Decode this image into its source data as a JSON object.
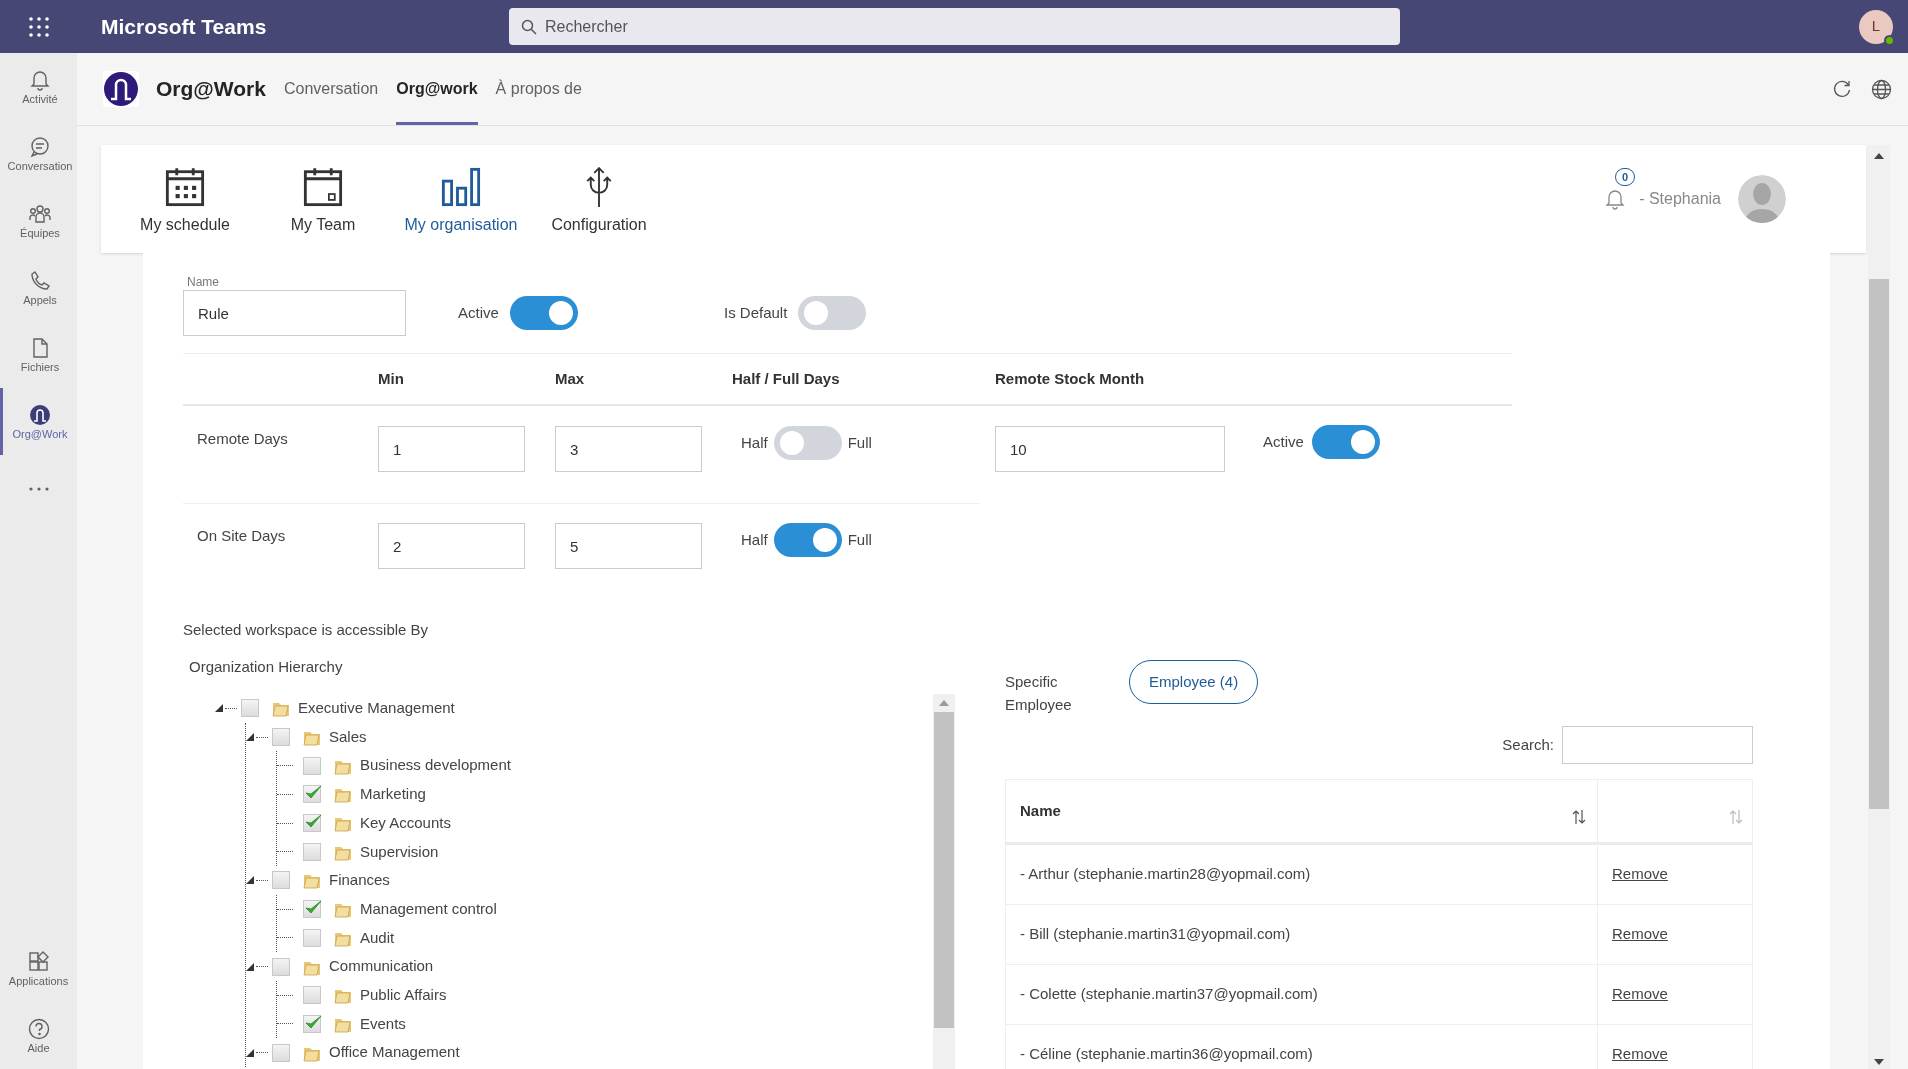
{
  "app_bar": {
    "title": "Microsoft Teams",
    "search": {
      "placeholder": "Rechercher"
    },
    "avatar": "L"
  },
  "rail": {
    "items": [
      {
        "label": "Activité",
        "selected": false
      },
      {
        "label": "Conversation",
        "selected": false
      },
      {
        "label": "Équipes",
        "selected": false
      },
      {
        "label": "Appels",
        "selected": false
      },
      {
        "label": "Fichiers",
        "selected": false
      },
      {
        "label": "Org@Work",
        "selected": true
      }
    ],
    "bottom_items": [
      {
        "label": "Applications"
      },
      {
        "label": "Aide"
      }
    ]
  },
  "app_header": {
    "name": "Org@Work",
    "tabs": [
      {
        "label": "Conversation",
        "selected": false
      },
      {
        "label": "Org@work",
        "selected": true
      },
      {
        "label": "À propos de",
        "selected": false
      }
    ]
  },
  "nav": {
    "items": [
      {
        "label": "My schedule",
        "selected": false
      },
      {
        "label": "My Team",
        "selected": false
      },
      {
        "label": "My organisation",
        "selected": true
      },
      {
        "label": "Configuration",
        "selected": false
      }
    ],
    "notification_count": "0",
    "user": "- Stephania"
  },
  "form": {
    "name": {
      "label": "Name",
      "value": "Rule"
    },
    "active": {
      "label": "Active",
      "on": true
    },
    "is_default": {
      "label": "Is Default",
      "on": false
    },
    "columns": [
      "Min",
      "Max",
      "Half / Full Days",
      "Remote Stock Month"
    ],
    "rows": [
      {
        "label": "Remote Days",
        "min": "1",
        "max": "3",
        "half_label": "Half",
        "full_label": "Full",
        "full": false,
        "stock": "10",
        "active_label": "Active",
        "active": true
      },
      {
        "label": "On Site Days",
        "min": "2",
        "max": "5",
        "half_label": "Half",
        "full_label": "Full",
        "full": true
      }
    ]
  },
  "access": {
    "title": "Selected workspace is accessible By",
    "hierarchy_title": "Organization Hierarchy",
    "tree": [
      {
        "label": "Executive Management",
        "checked": false,
        "expanded": true,
        "children": [
          {
            "label": "Sales",
            "checked": false,
            "expanded": true,
            "children": [
              {
                "label": "Business development",
                "checked": false
              },
              {
                "label": "Marketing",
                "checked": true
              },
              {
                "label": "Key Accounts",
                "checked": true
              },
              {
                "label": "Supervision",
                "checked": false
              }
            ]
          },
          {
            "label": "Finances",
            "checked": false,
            "expanded": true,
            "children": [
              {
                "label": "Management control",
                "checked": true
              },
              {
                "label": "Audit",
                "checked": false
              }
            ]
          },
          {
            "label": "Communication",
            "checked": false,
            "expanded": true,
            "children": [
              {
                "label": "Public Affairs",
                "checked": false
              },
              {
                "label": "Events",
                "checked": true
              }
            ]
          },
          {
            "label": "Office Management",
            "checked": false,
            "expanded": true
          }
        ]
      }
    ]
  },
  "specific": {
    "label": "Specific Employee",
    "button": "Employee (4)",
    "search_label": "Search:",
    "table": {
      "columns": [
        "Name"
      ],
      "rows": [
        {
          "name": "- Arthur (stephanie.martin28@yopmail.com)",
          "action": "Remove"
        },
        {
          "name": "- Bill (stephanie.martin31@yopmail.com)",
          "action": "Remove"
        },
        {
          "name": "- Colette (stephanie.martin37@yopmail.com)",
          "action": "Remove"
        },
        {
          "name": "- Céline (stephanie.martin36@yopmail.com)",
          "action": "Remove"
        }
      ]
    }
  }
}
